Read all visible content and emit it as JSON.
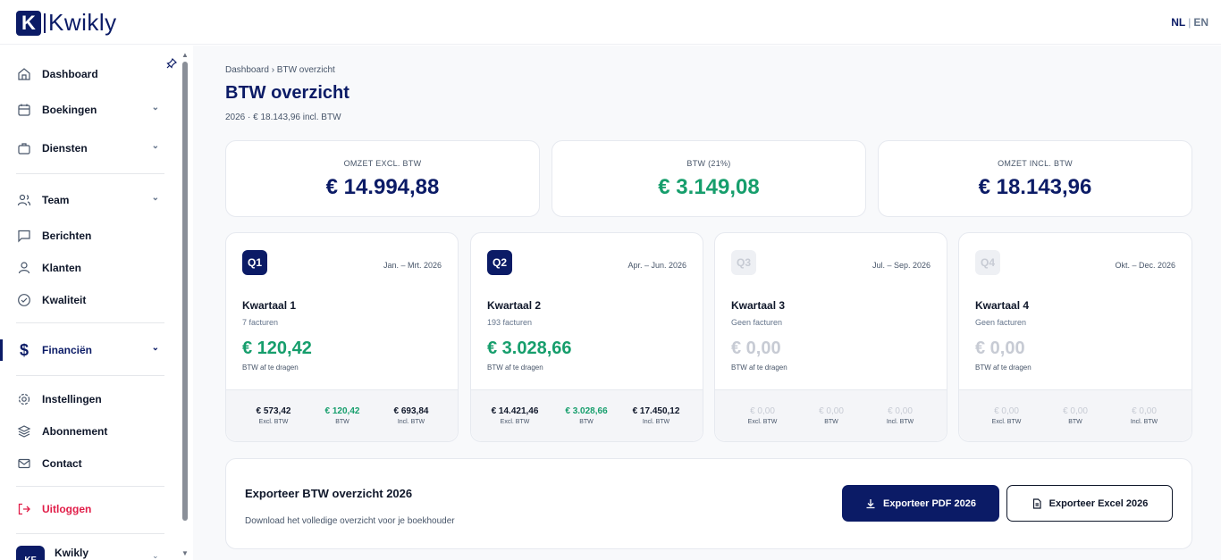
{
  "header": {
    "logo_mark": "K",
    "logo_text": "Kwikly",
    "lang_active": "NL",
    "lang_sep": "|",
    "lang_inactive": "EN"
  },
  "sidebar": {
    "items": [
      {
        "label": "Dashboard",
        "icon": "home-icon"
      },
      {
        "label": "Boekingen",
        "icon": "calendar-icon"
      },
      {
        "label": "Diensten",
        "icon": "briefcase-icon"
      },
      {
        "label": "Team",
        "icon": "users-icon"
      },
      {
        "label": "Berichten",
        "icon": "message-icon"
      },
      {
        "label": "Klanten",
        "icon": "user-icon"
      },
      {
        "label": "Kwaliteit",
        "icon": "check-circle-icon"
      },
      {
        "label": "Financiën",
        "icon": "dollar-icon"
      },
      {
        "label": "Instellingen",
        "icon": "gear-icon"
      },
      {
        "label": "Abonnement",
        "icon": "layers-icon"
      },
      {
        "label": "Contact",
        "icon": "mail-icon"
      },
      {
        "label": "Uitloggen",
        "icon": "logout-icon"
      }
    ],
    "user": {
      "initials": "KF",
      "name": "Kwikly"
    }
  },
  "page": {
    "breadcrumb": "Dashboard › BTW overzicht",
    "title": "BTW overzicht",
    "subtitle": "2026 · € 18.143,96 incl. BTW"
  },
  "stats": [
    {
      "label": "OMZET EXCL. BTW",
      "value": "€ 14.994,88"
    },
    {
      "label": "BTW (21%)",
      "value": "€ 3.149,08"
    },
    {
      "label": "OMZET INCL. BTW",
      "value": "€ 18.143,96"
    }
  ],
  "quarters": [
    {
      "badge": "Q1",
      "period": "Jan. – Mrt. 2026",
      "name": "Kwartaal 1",
      "count": "7 facturen",
      "amount": "€ 120,42",
      "amount_label": "BTW af te dragen",
      "excl": "€ 573,42",
      "btw": "€ 120,42",
      "incl": "€ 693,84",
      "excl_label": "Excl. BTW",
      "btw_label": "BTW",
      "incl_label": "Incl. BTW"
    },
    {
      "badge": "Q2",
      "period": "Apr. – Jun. 2026",
      "name": "Kwartaal 2",
      "count": "193 facturen",
      "amount": "€ 3.028,66",
      "amount_label": "BTW af te dragen",
      "excl": "€ 14.421,46",
      "btw": "€ 3.028,66",
      "incl": "€ 17.450,12",
      "excl_label": "Excl. BTW",
      "btw_label": "BTW",
      "incl_label": "Incl. BTW"
    },
    {
      "badge": "Q3",
      "period": "Jul. – Sep. 2026",
      "name": "Kwartaal 3",
      "count": "Geen facturen",
      "amount": "€ 0,00",
      "amount_label": "BTW af te dragen",
      "excl": "€ 0,00",
      "btw": "€ 0,00",
      "incl": "€ 0,00",
      "excl_label": "Excl. BTW",
      "btw_label": "BTW",
      "incl_label": "Incl. BTW"
    },
    {
      "badge": "Q4",
      "period": "Okt. – Dec. 2026",
      "name": "Kwartaal 4",
      "count": "Geen facturen",
      "amount": "€ 0,00",
      "amount_label": "BTW af te dragen",
      "excl": "€ 0,00",
      "btw": "€ 0,00",
      "incl": "€ 0,00",
      "excl_label": "Excl. BTW",
      "btw_label": "BTW",
      "incl_label": "Incl. BTW"
    }
  ],
  "export": {
    "title": "Exporteer BTW overzicht 2026",
    "description": "Download het volledige overzicht voor je boekhouder",
    "pdf_label": "Exporteer PDF 2026",
    "excel_label": "Exporteer Excel 2026"
  },
  "colors": {
    "brand": "#0b1b66",
    "accent_green": "#169e6c",
    "danger": "#e11d48"
  }
}
